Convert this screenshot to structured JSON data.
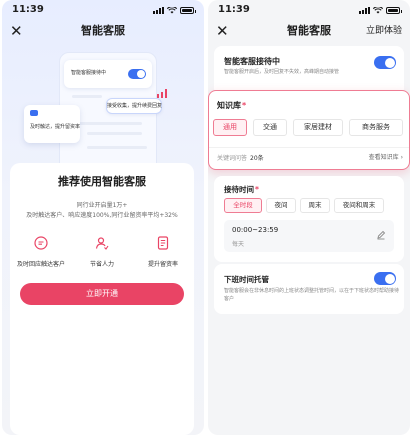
{
  "status_bar": {
    "time": "11:39"
  },
  "left_screen": {
    "nav_title": "智能客服",
    "illustration": {
      "toggle_card_text": "智能客服接待中",
      "bubble_right": "接受收集，提升续费回复",
      "bubble_left": "及时触达，提升留资率"
    },
    "promo": {
      "title": "推荐使用智能客服",
      "desc_line1": "同行业开启量1万+",
      "desc_line2": "及时触达客户、响应速度100%,同行业留资率平均+32%",
      "features": [
        {
          "label": "及时回应触达客户",
          "icon": "chat-bubble-icon"
        },
        {
          "label": "节省人力",
          "icon": "person-icon"
        },
        {
          "label": "提升留资率",
          "icon": "document-icon"
        }
      ],
      "cta_label": "立即开通"
    }
  },
  "right_screen": {
    "nav_title": "智能客服",
    "nav_right": "立即体验",
    "ai_reception": {
      "title": "智能客服接待中",
      "desc": "智能客服开启后，及时回复不失效，高峰期自动接管",
      "enabled": true
    },
    "knowledge_base": {
      "title": "知识库",
      "required_mark": "*",
      "chips": [
        "通用",
        "交通",
        "家居建材",
        "商务服务"
      ],
      "active_chip": "通用",
      "count_label": "关键词问答",
      "count_value": "20条",
      "link_label": "查看知识库",
      "link_arrow": "›"
    },
    "reception_time": {
      "title": "接待时间",
      "required_mark": "*",
      "chips": [
        "全时段",
        "夜间",
        "周末",
        "夜间和周末"
      ],
      "active_chip": "全时段",
      "time_range": "00:00~23:59",
      "time_sub": "每天"
    },
    "offshift": {
      "title": "下班时间托管",
      "desc": "智能客服会在非休息时间的上班状态调整托管时间，以在于下班状态时帮助接待客户",
      "enabled": true
    }
  },
  "colors": {
    "accent": "#e94465",
    "toggle": "#3a6ff0",
    "highlight_border": "#ef7c93"
  }
}
